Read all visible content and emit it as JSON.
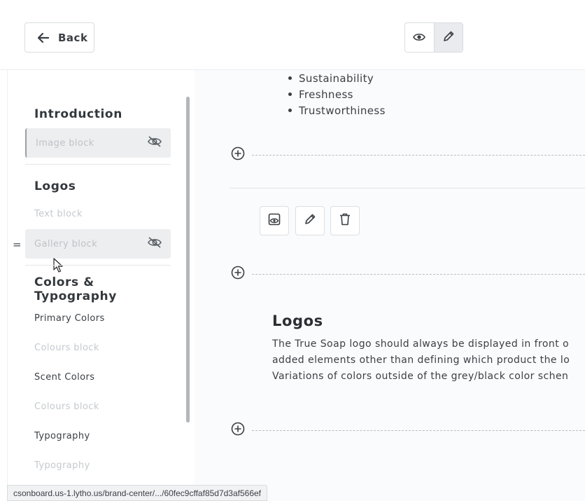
{
  "header": {
    "back_label": "Back"
  },
  "sidebar": {
    "sections": [
      {
        "title": "Introduction"
      },
      {
        "title": "Logos"
      },
      {
        "title": "Colors &\nTypography"
      }
    ],
    "items": {
      "intro_image": "Image block",
      "logos_text": "Text block",
      "logos_gallery": "Gallery block",
      "primary_colors": "Primary Colors",
      "colours_block_1": "Colours block",
      "scent_colors": "Scent Colors",
      "colours_block_2": "Colours block",
      "typography": "Typography",
      "typography_block": "Typography"
    },
    "drag_handle": "="
  },
  "content": {
    "bullets": [
      "Sustainability",
      "Freshness",
      "Trustworthiness"
    ],
    "logos_title": "Logos",
    "logos_lines": [
      "The True Soap logo should always be displayed in front o",
      "added elements other than defining which product the lo",
      "Variations of colors outside of the grey/black color schen"
    ]
  },
  "status_url": "csonboard.us-1.lytho.us/brand-center/.../60fec9cffaf85d7d3af566ef",
  "colors": {
    "accent_bg": "#e9ebee",
    "hidden_item_bg": "#eceef0",
    "text_dark": "#2b2f33"
  }
}
